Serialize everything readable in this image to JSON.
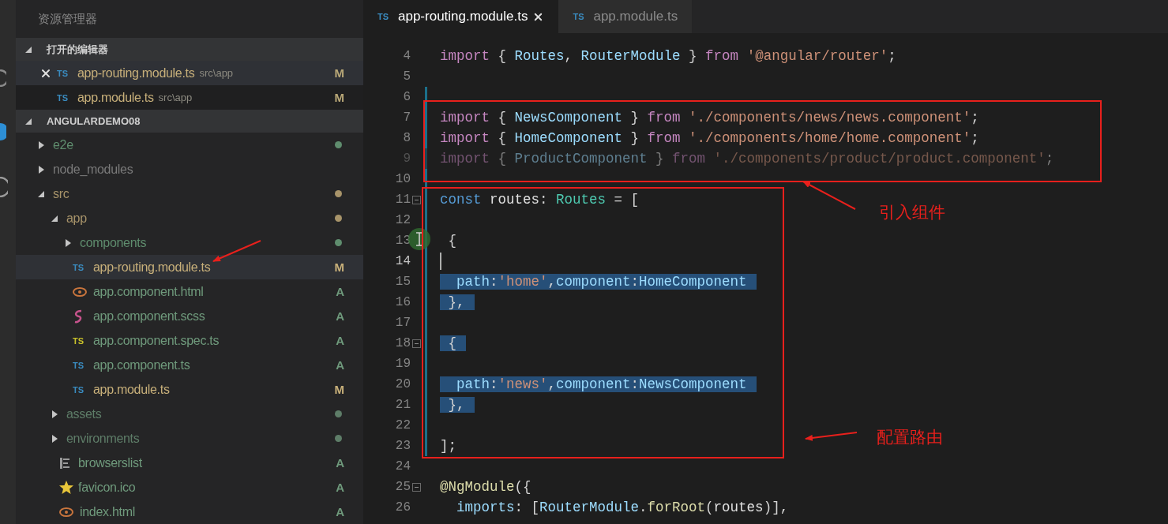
{
  "sidebar": {
    "title": "资源管理器",
    "open_editors": {
      "title": "打开的编辑器",
      "expanded": true,
      "items": [
        {
          "icon_text": "TS",
          "name": "app-routing.module.ts",
          "path": "src\\app",
          "badge": "M",
          "selected": true
        },
        {
          "icon_text": "TS",
          "name": "app.module.ts",
          "path": "src\\app",
          "badge": "M",
          "selected": false
        }
      ]
    },
    "project": {
      "title": "ANGULARDEMO08",
      "expanded": true,
      "tree": [
        {
          "kind": "folder",
          "name": "e2e",
          "expanded": false,
          "color": "#5f8d6e",
          "dot": true,
          "selected": false
        },
        {
          "kind": "folder",
          "name": "node_modules",
          "expanded": false,
          "color": "#7a7a7a",
          "dot": false,
          "selected": false
        },
        {
          "kind": "folder",
          "name": "src",
          "expanded": true,
          "color": "#a8946a",
          "dot": true,
          "selected": false,
          "children": [
            {
              "kind": "folder",
              "name": "app",
              "expanded": true,
              "color": "#a8946a",
              "dot": true,
              "selected": false,
              "children": [
                {
                  "kind": "folder",
                  "name": "components",
                  "expanded": false,
                  "color": "#5f8d6e",
                  "dot": true,
                  "selected": false
                },
                {
                  "kind": "ts",
                  "icon_text": "TS",
                  "name": "app-routing.module.ts",
                  "color": "#c8b07a",
                  "badge": "M",
                  "selected": true
                },
                {
                  "kind": "html",
                  "name": "app.component.html",
                  "color": "#6f9a7c",
                  "badge": "A",
                  "selected": false
                },
                {
                  "kind": "scss",
                  "name": "app.component.scss",
                  "color": "#6f9a7c",
                  "badge": "A",
                  "selected": false
                },
                {
                  "kind": "spec",
                  "icon_text": "TS",
                  "name": "app.component.spec.ts",
                  "color": "#6f9a7c",
                  "badge": "A",
                  "selected": false
                },
                {
                  "kind": "ts",
                  "icon_text": "TS",
                  "name": "app.component.ts",
                  "color": "#6f9a7c",
                  "badge": "A",
                  "selected": false
                },
                {
                  "kind": "ts",
                  "icon_text": "TS",
                  "name": "app.module.ts",
                  "color": "#c8b07a",
                  "badge": "M",
                  "selected": false
                }
              ]
            },
            {
              "kind": "folder",
              "name": "assets",
              "expanded": false,
              "color": "#5e7d68",
              "dot": true,
              "selected": false
            },
            {
              "kind": "folder",
              "name": "environments",
              "expanded": false,
              "color": "#5e7d68",
              "dot": true,
              "selected": false
            },
            {
              "kind": "list",
              "name": "browserslist",
              "color": "#6f9a7c",
              "badge": "A",
              "selected": false
            },
            {
              "kind": "star",
              "name": "favicon.ico",
              "color": "#6f9a7c",
              "badge": "A",
              "selected": false
            },
            {
              "kind": "html",
              "name": "index.html",
              "color": "#6f9a7c",
              "badge": "A",
              "selected": false
            }
          ]
        }
      ]
    }
  },
  "tabs": [
    {
      "icon_text": "TS",
      "label": "app-routing.module.ts",
      "selected": true
    },
    {
      "icon_text": "TS",
      "label": "app.module.ts",
      "selected": false
    }
  ],
  "editor": {
    "lines": [
      {
        "number": "4",
        "changed": false,
        "dim": false,
        "highlighted": false,
        "tokens": [
          {
            "kind": "kw",
            "text": "import"
          },
          {
            "kind": "p",
            "text": " { "
          },
          {
            "kind": "cls",
            "text": "Routes"
          },
          {
            "kind": "p",
            "text": ", "
          },
          {
            "kind": "cls",
            "text": "RouterModule"
          },
          {
            "kind": "p",
            "text": " } "
          },
          {
            "kind": "kw",
            "text": "from"
          },
          {
            "kind": "str",
            "text": " '@angular/router'"
          },
          {
            "kind": "p",
            "text": ";"
          }
        ]
      },
      {
        "number": "5",
        "changed": false,
        "dim": false,
        "highlighted": false
      },
      {
        "number": "6",
        "changed": true,
        "dim": false,
        "highlighted": false
      },
      {
        "number": "7",
        "changed": true,
        "dim": false,
        "highlighted": false,
        "tokens": [
          {
            "kind": "kw",
            "text": "import"
          },
          {
            "kind": "p",
            "text": " { "
          },
          {
            "kind": "cls",
            "text": "NewsComponent"
          },
          {
            "kind": "p",
            "text": " } "
          },
          {
            "kind": "kw",
            "text": "from"
          },
          {
            "kind": "str",
            "text": " './components/news/news.component'"
          },
          {
            "kind": "p",
            "text": ";"
          }
        ]
      },
      {
        "number": "8",
        "changed": true,
        "dim": false,
        "highlighted": false,
        "tokens": [
          {
            "kind": "kw",
            "text": "import"
          },
          {
            "kind": "p",
            "text": " { "
          },
          {
            "kind": "cls",
            "text": "HomeComponent"
          },
          {
            "kind": "p",
            "text": " } "
          },
          {
            "kind": "kw",
            "text": "from"
          },
          {
            "kind": "str",
            "text": " './components/home/home.component'"
          },
          {
            "kind": "p",
            "text": ";"
          }
        ]
      },
      {
        "number": "9",
        "changed": true,
        "dim": true,
        "highlighted": false,
        "tokens": [
          {
            "kind": "kw",
            "text": "import"
          },
          {
            "kind": "p",
            "text": " { "
          },
          {
            "kind": "cls",
            "text": "ProductComponent"
          },
          {
            "kind": "p",
            "text": " } "
          },
          {
            "kind": "kw",
            "text": "from"
          },
          {
            "kind": "str",
            "text": " './components/product/product.component'"
          },
          {
            "kind": "p",
            "text": ";"
          }
        ]
      },
      {
        "number": "10",
        "changed": true,
        "dim": false,
        "highlighted": false
      },
      {
        "number": "11",
        "changed": true,
        "dim": false,
        "highlighted": false,
        "fold": true,
        "tokens": [
          {
            "kind": "storage",
            "text": "const"
          },
          {
            "kind": "var",
            "text": " routes"
          },
          {
            "kind": "p",
            "text": ": "
          },
          {
            "kind": "type",
            "text": "Routes"
          },
          {
            "kind": "p",
            "text": " = ["
          }
        ]
      },
      {
        "number": "12",
        "changed": true,
        "dim": false,
        "highlighted": false
      },
      {
        "number": "13",
        "changed": true,
        "dim": false,
        "highlighted": false,
        "pointer": true,
        "tokens": [
          {
            "kind": "p",
            "text": " {"
          }
        ]
      },
      {
        "number": "14",
        "changed": true,
        "dim": false,
        "highlighted": false,
        "cursor": true
      },
      {
        "number": "15",
        "changed": true,
        "dim": false,
        "highlighted": true,
        "tokens": [
          {
            "kind": "prop",
            "text": "  path"
          },
          {
            "kind": "p",
            "text": ":"
          },
          {
            "kind": "str",
            "text": "'home'"
          },
          {
            "kind": "p",
            "text": ","
          },
          {
            "kind": "prop",
            "text": "component"
          },
          {
            "kind": "p",
            "text": ":"
          },
          {
            "kind": "cls",
            "text": "HomeComponent"
          }
        ]
      },
      {
        "number": "16",
        "changed": true,
        "dim": false,
        "highlighted": true,
        "tokens": [
          {
            "kind": "p",
            "text": " },"
          }
        ]
      },
      {
        "number": "17",
        "changed": true,
        "dim": false,
        "highlighted": false
      },
      {
        "number": "18",
        "changed": true,
        "dim": false,
        "highlighted": true,
        "fold": true,
        "tokens": [
          {
            "kind": "p",
            "text": " {"
          }
        ]
      },
      {
        "number": "19",
        "changed": true,
        "dim": false,
        "highlighted": false
      },
      {
        "number": "20",
        "changed": true,
        "dim": false,
        "highlighted": true,
        "tokens": [
          {
            "kind": "prop",
            "text": "  path"
          },
          {
            "kind": "p",
            "text": ":"
          },
          {
            "kind": "str",
            "text": "'news'"
          },
          {
            "kind": "p",
            "text": ","
          },
          {
            "kind": "prop",
            "text": "component"
          },
          {
            "kind": "p",
            "text": ":"
          },
          {
            "kind": "cls",
            "text": "NewsComponent"
          }
        ]
      },
      {
        "number": "21",
        "changed": true,
        "dim": false,
        "highlighted": true,
        "tokens": [
          {
            "kind": "p",
            "text": " },"
          }
        ]
      },
      {
        "number": "22",
        "changed": true,
        "dim": false,
        "highlighted": false
      },
      {
        "number": "23",
        "changed": true,
        "dim": false,
        "highlighted": false,
        "tokens": [
          {
            "kind": "p",
            "text": "];"
          }
        ]
      },
      {
        "number": "24",
        "changed": false,
        "dim": false,
        "highlighted": false
      },
      {
        "number": "25",
        "changed": false,
        "dim": false,
        "highlighted": false,
        "fold": true,
        "tokens": [
          {
            "kind": "deco",
            "text": "@NgModule"
          },
          {
            "kind": "p",
            "text": "({"
          }
        ]
      },
      {
        "number": "26",
        "changed": false,
        "dim": false,
        "highlighted": false,
        "tokens": [
          {
            "kind": "prop",
            "text": "  imports"
          },
          {
            "kind": "p",
            "text": ": ["
          },
          {
            "kind": "cls",
            "text": "RouterModule"
          },
          {
            "kind": "p",
            "text": "."
          },
          {
            "kind": "fn",
            "text": "forRoot"
          },
          {
            "kind": "p",
            "text": "("
          },
          {
            "kind": "var",
            "text": "routes"
          },
          {
            "kind": "p",
            "text": ")],"
          }
        ]
      }
    ]
  },
  "annotations": [
    {
      "label": "引入组件"
    },
    {
      "label": "配置路由"
    }
  ]
}
